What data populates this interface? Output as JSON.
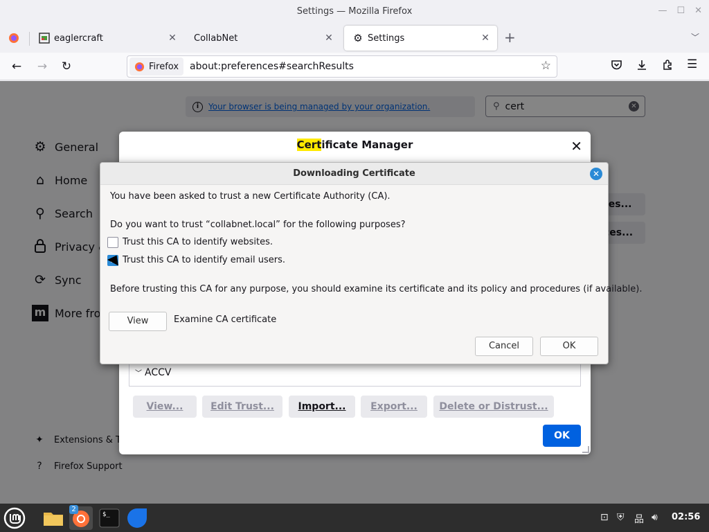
{
  "window": {
    "title": "Settings — Mozilla Firefox"
  },
  "tabs": [
    {
      "label": "eaglercraft"
    },
    {
      "label": "CollabNet"
    },
    {
      "label": "Settings",
      "active": true
    }
  ],
  "navbar": {
    "identity_label": "Firefox",
    "url": "about:preferences#searchResults"
  },
  "prefs": {
    "managed_notice": "Your browser is being managed by your organization.",
    "search_value": "cert",
    "categories": [
      {
        "label": "General",
        "icon": "gear-icon"
      },
      {
        "label": "Home",
        "icon": "home-icon"
      },
      {
        "label": "Search",
        "icon": "search-icon"
      },
      {
        "label": "Privacy &",
        "icon": "lock-icon"
      },
      {
        "label": "Sync",
        "icon": "sync-icon"
      },
      {
        "label": "More fro",
        "icon": "mozilla-icon"
      }
    ],
    "footer": {
      "extensions": "Extensions & Th",
      "support": "Firefox Support"
    },
    "side_buttons": [
      "tes...",
      "ces..."
    ]
  },
  "cert_manager": {
    "title_highlight": "Cert",
    "title_rest": "ificate Manager",
    "tree_row": "ACCV",
    "buttons": {
      "view": "View...",
      "edit_trust": "Edit Trust...",
      "import": "Import...",
      "export": "Export...",
      "delete": "Delete or Distrust..."
    },
    "ok": "OK"
  },
  "download_dialog": {
    "title": "Downloading Certificate",
    "intro": "You have been asked to trust a new Certificate Authority (CA).",
    "question": "Do you want to trust “collabnet.local” for the following purposes?",
    "option_websites": "Trust this CA to identify websites.",
    "option_email": "Trust this CA to identify email users.",
    "option_websites_checked": false,
    "option_email_checked": true,
    "advice": "Before trusting this CA for any purpose, you should examine its certificate and its policy and procedures (if available).",
    "view_button": "View",
    "examine_label": "Examine CA certificate",
    "cancel": "Cancel",
    "ok": "OK"
  },
  "taskbar": {
    "firefox_badge": "2",
    "clock": "02:56"
  },
  "colors": {
    "accent_blue": "#0061e0",
    "dialog_blue": "#2a8ad6",
    "highlight": "#ffe900",
    "taskbar": "#2d2d2d"
  }
}
